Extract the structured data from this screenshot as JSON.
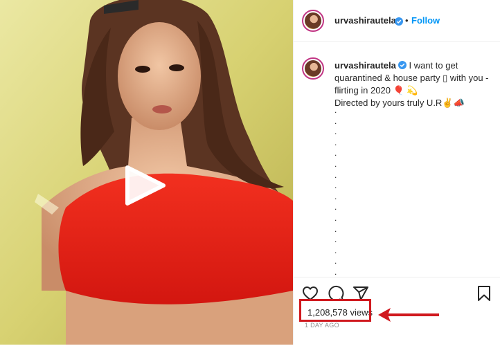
{
  "post": {
    "username": "urvashirautela",
    "follow_label": "Follow",
    "separator": "•",
    "caption": {
      "username": "urvashirautela",
      "line1": " I want to get quarantined & house party ▯ with you - flirting in 2020 🎈 💫",
      "line2": "Directed by yours truly U.R✌️📣",
      "dots": [
        ".",
        ".",
        ".",
        ".",
        ".",
        ".",
        ".",
        ".",
        ".",
        ".",
        ".",
        ".",
        ".",
        ".",
        ".",
        "."
      ]
    },
    "views": "1,208,578 views",
    "time": "1 DAY AGO"
  },
  "colors": {
    "accent": "#0095f6",
    "annotation": "#d0191f",
    "media_background": "#d8d27a",
    "top_red": "#e8241c"
  },
  "icons": [
    "play-icon",
    "verified-icon",
    "heart-icon",
    "comment-icon",
    "share-icon",
    "bookmark-icon",
    "annotation-arrow"
  ]
}
